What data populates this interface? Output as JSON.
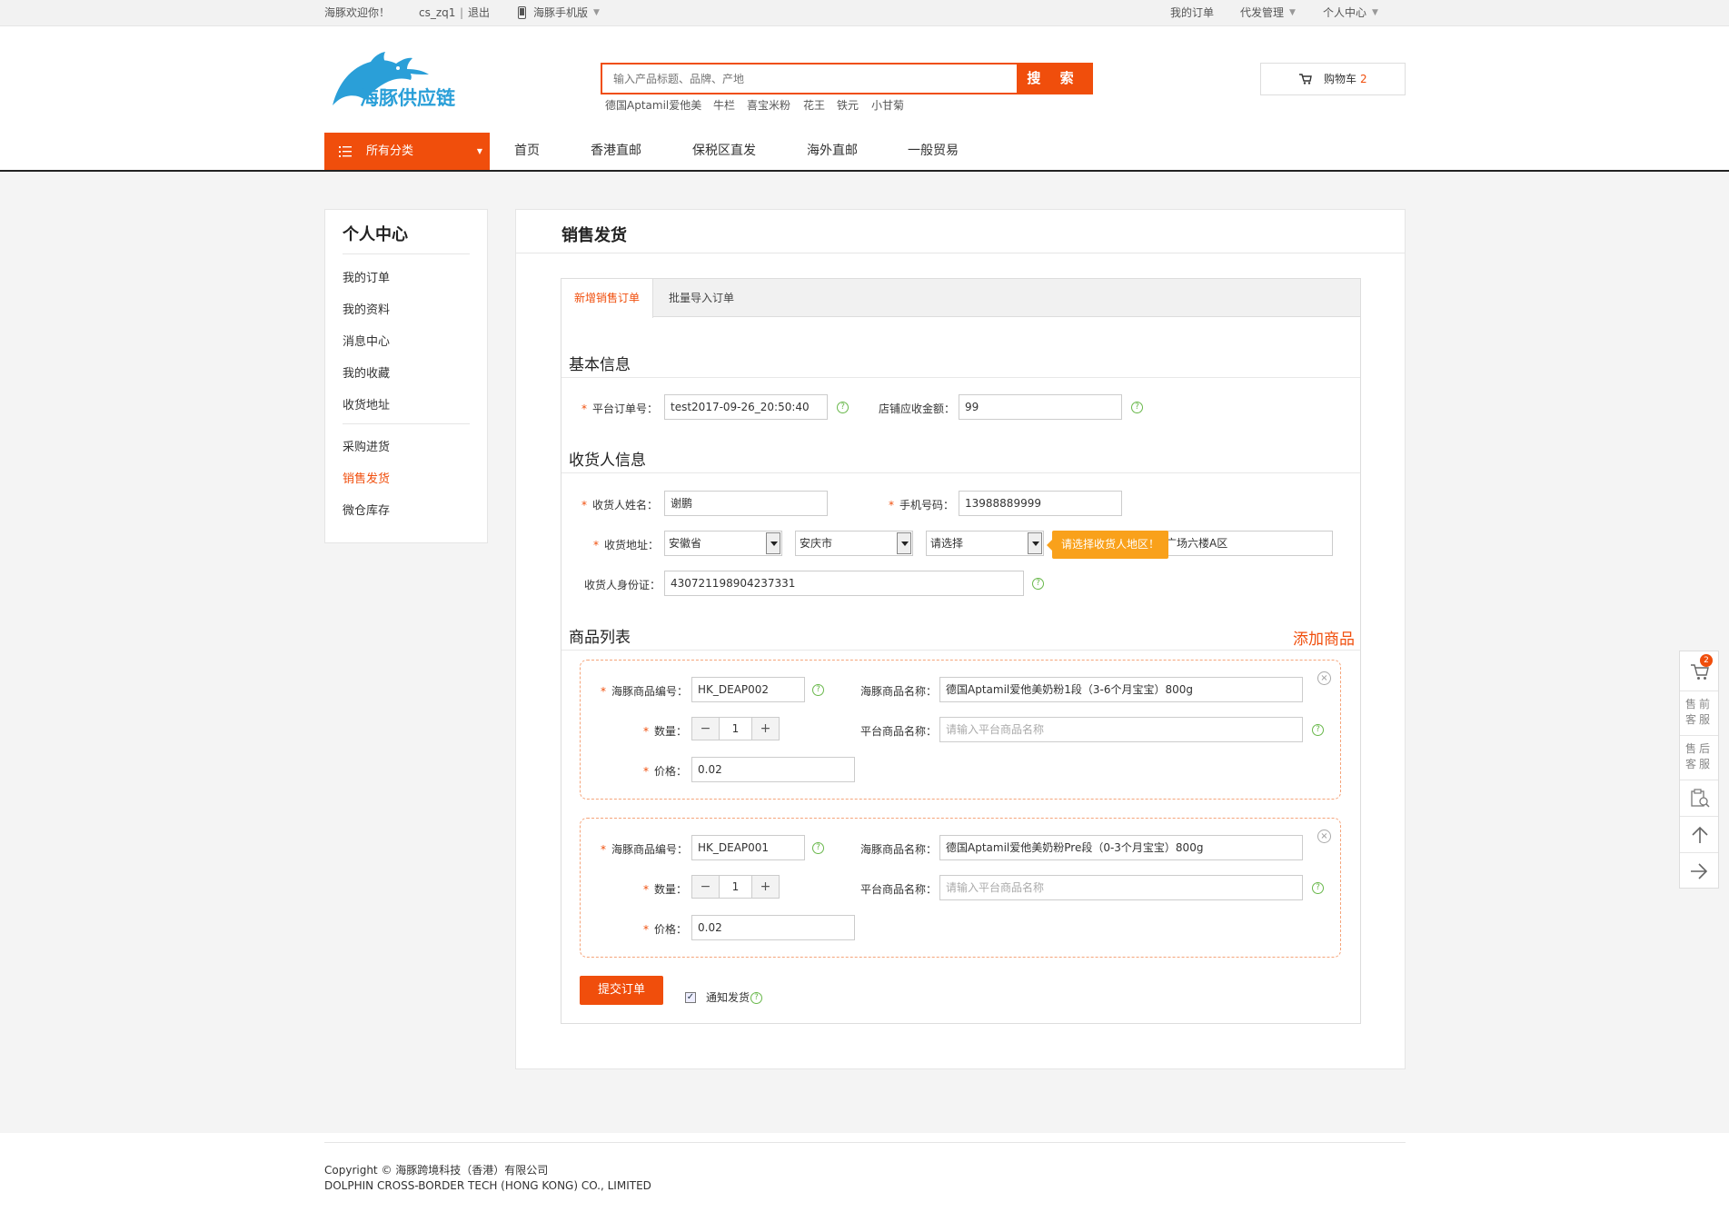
{
  "topbar": {
    "welcome": "海豚欢迎你！",
    "user": "cs_zq1",
    "logout": "退出",
    "mobile": "海豚手机版",
    "my_orders": "我的订单",
    "dropship": "代发管理",
    "user_center": "个人中心"
  },
  "header": {
    "logo_text": "海豚供应链",
    "search_placeholder": "输入产品标题、品牌、产地",
    "search_button": "搜 索",
    "hot_words": [
      "德国Aptamil爱他美",
      "牛栏",
      "喜宝米粉",
      "花王",
      "铁元",
      "小甘菊"
    ],
    "cart_label": "购物车",
    "cart_count": "2"
  },
  "nav": {
    "all_categories": "所有分类",
    "links": [
      "首页",
      "香港直邮",
      "保税区直发",
      "海外直邮",
      "一般贸易"
    ]
  },
  "sidebar": {
    "title": "个人中心",
    "group1": [
      "我的订单",
      "我的资料",
      "消息中心",
      "我的收藏",
      "收货地址"
    ],
    "group2": [
      "采购进货",
      "销售发货",
      "微仓库存"
    ],
    "active": "销售发货"
  },
  "main": {
    "title": "销售发货",
    "tabs": [
      "新增销售订单",
      "批量导入订单"
    ],
    "basic": {
      "title": "基本信息",
      "order_no_label": "平台订单号：",
      "order_no": "test2017-09-26_20:50:40",
      "amount_label": "店铺应收金额：",
      "amount": "99"
    },
    "consignee": {
      "title": "收货人信息",
      "name_label": "收货人姓名：",
      "name": "谢鹏",
      "phone_label": "手机号码：",
      "phone": "13988889999",
      "address_label": "收货地址：",
      "province": "安徽省",
      "city": "安庆市",
      "district": "请选择",
      "address_detail": "广场六楼A区",
      "tooltip": "请选择收货人地区！",
      "id_label": "收货人身份证：",
      "id_no": "430721198904237331"
    },
    "goods": {
      "title": "商品列表",
      "add": "添加商品",
      "code_label": "海豚商品编号：",
      "name_label": "海豚商品名称：",
      "qty_label": "数量：",
      "platform_name_label": "平台商品名称：",
      "price_label": "价格：",
      "platform_name_placeholder": "请输入平台商品名称",
      "items": [
        {
          "code": "HK_DEAP002",
          "name": "德国Aptamil爱他美奶粉1段（3-6个月宝宝）800g",
          "qty": "1",
          "price": "0.02"
        },
        {
          "code": "HK_DEAP001",
          "name": "德国Aptamil爱他美奶粉Pre段（0-3个月宝宝）800g",
          "qty": "1",
          "price": "0.02"
        }
      ]
    },
    "submit": "提交订单",
    "notify": "通知发货"
  },
  "footer": {
    "line1": "Copyright ©  海豚跨境科技（香港）有限公司",
    "line2": "DOLPHIN CROSS-BORDER TECH (HONG KONG) CO., LIMITED"
  },
  "rightbar": {
    "cart_badge": "2",
    "presale": "售前客服",
    "aftersale": "售后客服"
  },
  "colors": {
    "accent": "#f04e0c",
    "help": "#69b84b",
    "tooltip": "#f9a11b",
    "logo": "#2a9fd8"
  }
}
